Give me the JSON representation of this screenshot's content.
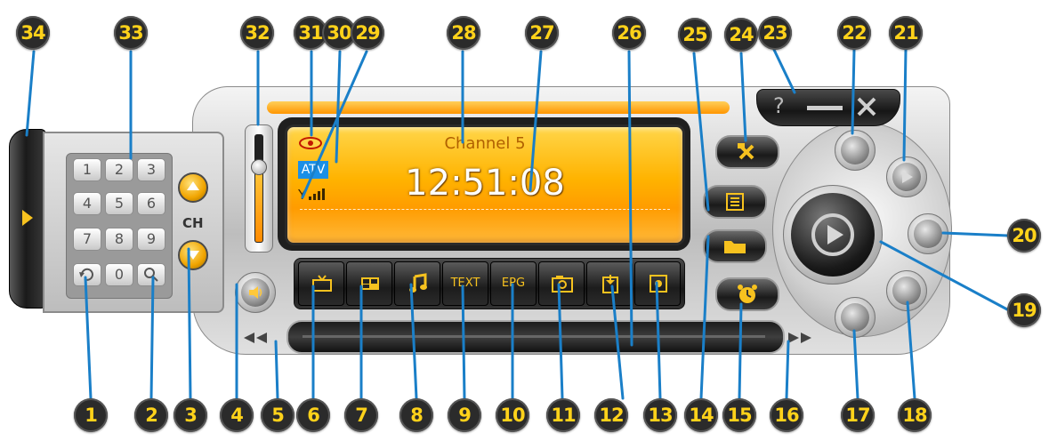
{
  "lcd": {
    "channel_name": "Channel 5",
    "time": "12:51:08",
    "source_badge": "ATV"
  },
  "keypad": {
    "keys": [
      "1",
      "2",
      "3",
      "4",
      "5",
      "6",
      "7",
      "8",
      "9",
      "0"
    ],
    "channel_label": "CH"
  },
  "function_bar": {
    "teletext_label": "TEXT",
    "epg_label": "EPG"
  },
  "window": {
    "help_label": "?"
  },
  "icons": {
    "visibility": "eye-icon",
    "signal": "signal-strength-icon",
    "volume": "speaker-icon",
    "tv": "tv-icon",
    "multiview": "multi-screen-icon",
    "audio": "music-note-icon",
    "snapshot": "camera-icon",
    "settings": "tools-icon",
    "playlist": "list-icon",
    "open": "folder-icon",
    "schedule": "alarm-clock-icon",
    "recall": "recall-icon",
    "search": "magnifier-icon",
    "play": "play-icon"
  },
  "colors": {
    "accent": "#ffb300",
    "marker_fill": "#2b2b2b",
    "marker_text": "#ffd21a",
    "leader": "#1a7fc8"
  },
  "markers": [
    "1",
    "2",
    "3",
    "4",
    "5",
    "6",
    "7",
    "8",
    "9",
    "10",
    "11",
    "12",
    "13",
    "14",
    "15",
    "16",
    "17",
    "18",
    "19",
    "20",
    "21",
    "22",
    "23",
    "24",
    "25",
    "26",
    "27",
    "28",
    "29",
    "30",
    "31",
    "32",
    "33",
    "34"
  ]
}
